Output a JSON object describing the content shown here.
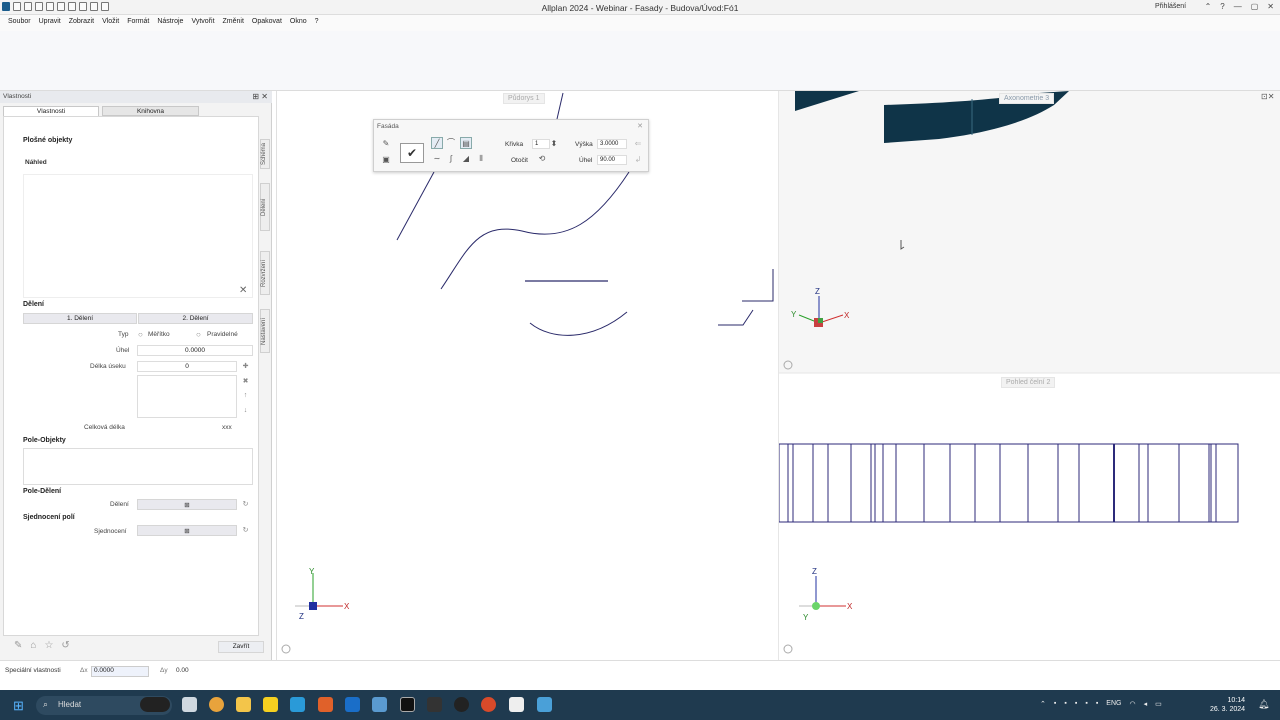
{
  "window": {
    "title": "Allplan 2024 - Webinar - Fasady - Budova/Úvod:Fó1",
    "login": "Přihlášení",
    "controls": [
      "⌃",
      "?",
      "—",
      "▢",
      "✕"
    ]
  },
  "menu": [
    "Soubor",
    "Upravit",
    "Zobrazit",
    "Vložit",
    "Formát",
    "Nástroje",
    "Vytvořit",
    "Změnit",
    "Opakovat",
    "Okno",
    "?"
  ],
  "panel": {
    "title": "Vlastnosti",
    "tabs": [
      "Vlastnosti",
      "Knihovna"
    ],
    "side_tabs": [
      "Schéma",
      "Dělení",
      "Rozvržení",
      "Nastavení"
    ],
    "heading": "Plošné objekty",
    "preview_label": "Náhled",
    "deleni_section": "Dělení",
    "deleni_tabs": [
      "1. Dělení",
      "2. Dělení"
    ],
    "typ_label": "Typ",
    "typ_options": [
      "Měřítko",
      "Pravidelné"
    ],
    "uhel_label": "Úhel",
    "uhel_value": "0.0000",
    "delka_label": "Délka úseku",
    "delka_value": "0",
    "celkova_label": "Celková délka",
    "celkova_value": "xxx",
    "pole_objekty": "Pole-Objekty",
    "pole_deleni": "Pole-Dělení",
    "deleni_row_label": "Dělení",
    "sjednoceni_section": "Sjednocení polí",
    "sjednoceni_row_label": "Sjednocení",
    "close_button": "Zavřít"
  },
  "viewports": {
    "left_label": "Půdorys 1",
    "axon_label": "Axonometrie 3",
    "front_label": "Pohled čelní 2"
  },
  "fasada_toolbar": {
    "title": "Fasáda",
    "krivka_label": "Křivka",
    "krivka_value": "1",
    "vyska_label": "Výška",
    "vyska_value": "3.0000",
    "uhel_label": "Úhel",
    "uhel_value": "90.00",
    "otocit_label": "Otočit"
  },
  "statusbar": {
    "special": "Speciální vlastnosti",
    "dx_label": "Δx",
    "dx_value": "0.0000",
    "dy_label": "Δy",
    "dy_value": "0.00"
  },
  "taskbar": {
    "search_placeholder": "Hledat",
    "lang": "ENG",
    "time": "10:14",
    "date": "26. 3. 2024"
  },
  "axes": {
    "x": "X",
    "y": "Y",
    "z": "Z"
  },
  "colors": {
    "taskbar": "#1f3a4f",
    "curve": "#2a2a6a",
    "facade_lines": "#2c2a7a",
    "axis_x": "#d03030",
    "axis_y": "#2aa02a",
    "axis_z": "#2030a0"
  }
}
